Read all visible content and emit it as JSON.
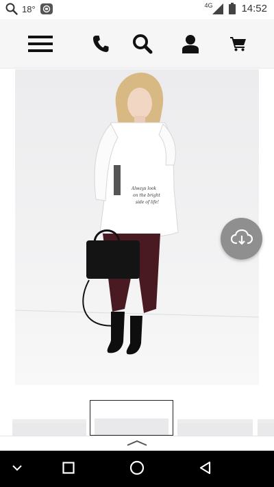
{
  "status_bar": {
    "temperature": "18°",
    "network": "4G",
    "time": "14:52"
  },
  "header": {
    "icons": [
      "menu-icon",
      "phone-icon",
      "search-icon",
      "account-icon",
      "cart-icon"
    ]
  },
  "product": {
    "shirt_print_text": "Always look on the bright side of life!",
    "thumbnails_visible": 4,
    "active_thumbnail": 2
  },
  "colors": {
    "header_bg": "#f6f6f6",
    "fab_bg": "#8f8f8f",
    "nav_bg": "#000000"
  }
}
